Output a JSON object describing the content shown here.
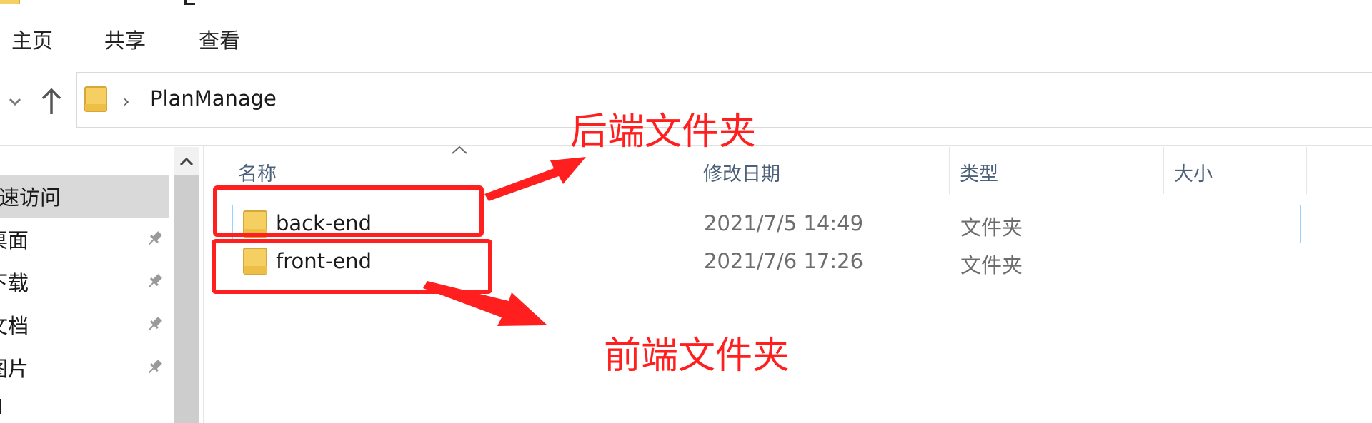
{
  "ribbon": {
    "tabs": [
      "主页",
      "共享",
      "查看"
    ]
  },
  "address": {
    "path": "PlanManage",
    "separator": "›"
  },
  "nav_pane": {
    "items": [
      {
        "label": "速访问",
        "pinned": false,
        "selected": true
      },
      {
        "label": "桌面",
        "pinned": true
      },
      {
        "label": "下载",
        "pinned": true
      },
      {
        "label": "文档",
        "pinned": true
      },
      {
        "label": "图片",
        "pinned": true
      },
      {
        "label": "I",
        "pinned": false
      }
    ]
  },
  "columns": {
    "name": "名称",
    "modified": "修改日期",
    "type": "类型",
    "size": "大小"
  },
  "files": [
    {
      "name": "back-end",
      "modified": "2021/7/5 14:49",
      "type": "文件夹",
      "size": "",
      "selected": true
    },
    {
      "name": "front-end",
      "modified": "2021/7/6 17:26",
      "type": "文件夹",
      "size": "",
      "selected": false
    }
  ],
  "annotations": {
    "backend_label": "后端文件夹",
    "frontend_label": "前端文件夹",
    "color": "#ff1f1f"
  },
  "colors": {
    "folder": "#f5cf62",
    "selection_border": "#99d1ff",
    "header_text": "#4c607a",
    "nav_selected": "#d9d9d9"
  }
}
